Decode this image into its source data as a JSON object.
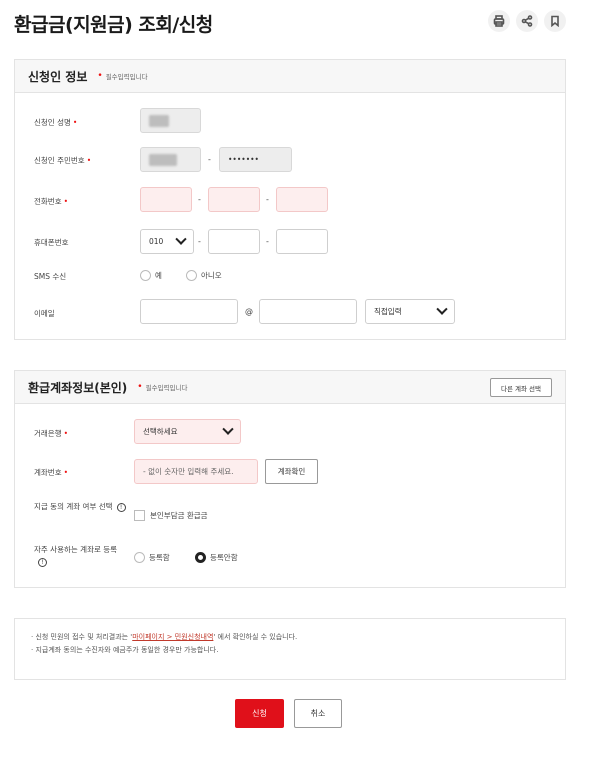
{
  "header": {
    "title": "환급금(지원금) 조회/신청",
    "icons": [
      "print-icon",
      "share-icon",
      "bookmark-icon"
    ]
  },
  "applicant": {
    "title": "신청인 정보",
    "required_note": "필수입력입니다",
    "name_label": "신청인 성명",
    "rrn_label": "신청인 주민번호",
    "rrn_back_masked": "•••••••",
    "phone_label": "전화번호",
    "mobile_label": "휴대폰번호",
    "mobile_prefix": "010",
    "sms_label": "SMS 수신",
    "sms_yes": "예",
    "sms_no": "아니오",
    "email_label": "이메일",
    "email_at": "@",
    "email_domain_select": "직접입력"
  },
  "account": {
    "title": "환급계좌정보(본인)",
    "required_note": "필수입력입니다",
    "other_account_btn": "다른 계좌 선택",
    "bank_label": "거래은행",
    "bank_select": "선택하세요",
    "account_label": "계좌번호",
    "account_placeholder": "- 없이 숫자만 입력해 주세요.",
    "verify_btn": "계좌확인",
    "consent_label": "지급 동의 계좌 여부 선택",
    "consent_checkbox": "본인부담금 환급금",
    "frequent_label": "자주 사용하는 계좌로 등록",
    "register_yes": "등록함",
    "register_no": "등록안함"
  },
  "notice": {
    "line1_prefix": "· 신청 민원의 접수 및 처리결과는 '",
    "line1_link": "마이페이지 > 민원신청내역",
    "line1_suffix": "' 에서 확인하실 수 있습니다.",
    "line2": "· 지급계좌 동의는 수진자와 예금주가 동일한 경우만 가능합니다."
  },
  "actions": {
    "apply": "신청",
    "cancel": "취소"
  },
  "colors": {
    "accent_red": "#e0101a",
    "required_red": "#e11111",
    "pink_field": "#fdeeee"
  }
}
